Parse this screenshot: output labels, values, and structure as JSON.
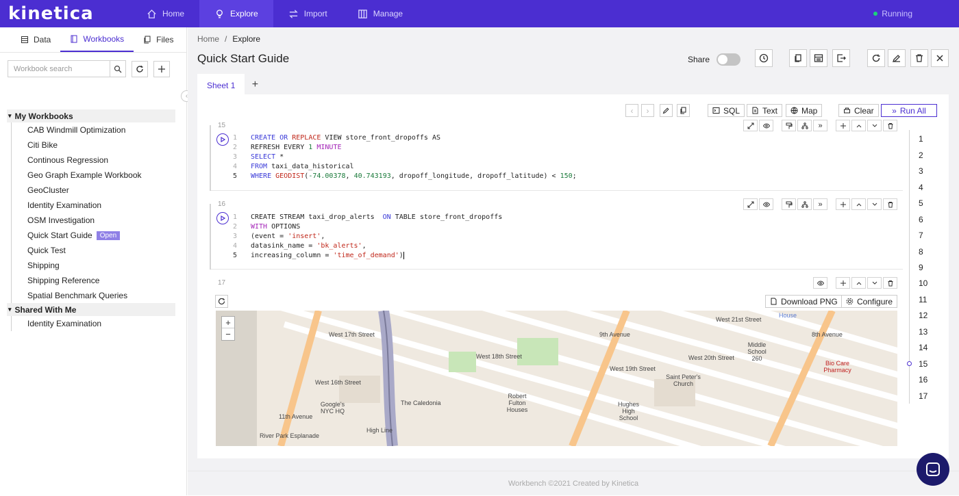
{
  "app": {
    "logo": "kinetica",
    "status": "Running"
  },
  "nav": [
    {
      "label": "Home",
      "icon": "home-icon"
    },
    {
      "label": "Explore",
      "icon": "bulb-icon",
      "active": true
    },
    {
      "label": "Import",
      "icon": "arrows-icon"
    },
    {
      "label": "Manage",
      "icon": "grid-icon"
    }
  ],
  "sidebar": {
    "tabs": [
      {
        "label": "Data"
      },
      {
        "label": "Workbooks",
        "active": true
      },
      {
        "label": "Files"
      }
    ],
    "search_placeholder": "Workbook search",
    "my_workbooks": {
      "heading": "My Workbooks",
      "items": [
        "CAB Windmill Optimization",
        "Citi Bike",
        "Continous Regression",
        "Geo Graph Example Workbook",
        "GeoCluster",
        "Identity Examination",
        "OSM Investigation",
        "Quick Start Guide",
        "Quick Test",
        "Shipping",
        "Shipping Reference",
        "Spatial Benchmark Queries"
      ],
      "open_badge": "Open"
    },
    "shared": {
      "heading": "Shared With Me",
      "items": [
        "Identity Examination"
      ]
    }
  },
  "main": {
    "breadcrumb": [
      "Home",
      "Explore"
    ],
    "title": "Quick Start Guide",
    "share_label": "Share",
    "sheet_tab": "Sheet 1",
    "toolbar": {
      "sql": "SQL",
      "text": "Text",
      "map": "Map",
      "clear": "Clear",
      "run_all": "Run All"
    },
    "blocks": [
      {
        "num": "15",
        "lines": [
          "CREATE OR REPLACE VIEW store_front_dropoffs AS",
          "REFRESH EVERY 1 MINUTE",
          "SELECT *",
          "FROM taxi_data_historical",
          "WHERE GEODIST(-74.00378, 40.743193, dropoff_longitude, dropoff_latitude) < 150;"
        ]
      },
      {
        "num": "16",
        "lines": [
          "CREATE STREAM taxi_drop_alerts  ON TABLE store_front_dropoffs",
          "WITH OPTIONS",
          "(event = 'insert',",
          "datasink_name = 'bk_alerts',",
          "increasing_column = 'time_of_demand')"
        ]
      },
      {
        "num": "17",
        "download": "Download PNG",
        "configure": "Configure"
      }
    ],
    "line_numbers": [
      "1",
      "2",
      "3",
      "4",
      "5"
    ],
    "map_labels": [
      "West 17th Street",
      "West 18th Street",
      "West 19th Street",
      "West 20th Street",
      "West 16th Street",
      "West 21st Street",
      "The Caledonia",
      "Google's NYC HQ",
      "Robert Fulton Houses",
      "Hughes High School",
      "Saint Peter's Church",
      "Middle School 260",
      "Bio Care Pharmacy",
      "9th Avenue",
      "8th Avenue",
      "11th Avenue",
      "High Line",
      "House",
      "River Park Esplanade"
    ]
  },
  "rail": [
    "1",
    "2",
    "3",
    "4",
    "5",
    "6",
    "7",
    "8",
    "9",
    "10",
    "11",
    "12",
    "13",
    "14",
    "15",
    "16",
    "17"
  ],
  "rail_active": "15",
  "footer": "Workbench ©2021 Created by Kinetica"
}
